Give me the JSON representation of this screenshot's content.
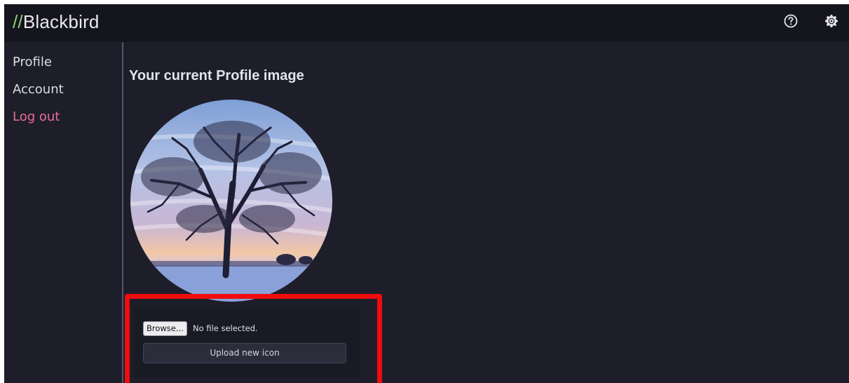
{
  "header": {
    "brand_slashes": "//",
    "brand_name": "Blackbird",
    "help_icon": "help-circle-icon",
    "settings_icon": "gear-icon"
  },
  "sidebar": {
    "items": [
      {
        "label": "Profile"
      },
      {
        "label": "Account"
      },
      {
        "label": "Log out"
      }
    ]
  },
  "main": {
    "title": "Your current Profile image",
    "upload": {
      "browse_label": "Browse...",
      "file_status": "No file selected.",
      "upload_label": "Upload new icon"
    }
  },
  "colors": {
    "header_bg": "#15151d",
    "page_bg": "#1e1e2a",
    "brand_accent": "#8fd07a",
    "logout_accent": "#e66f95",
    "highlight": "#ee0c0c"
  }
}
